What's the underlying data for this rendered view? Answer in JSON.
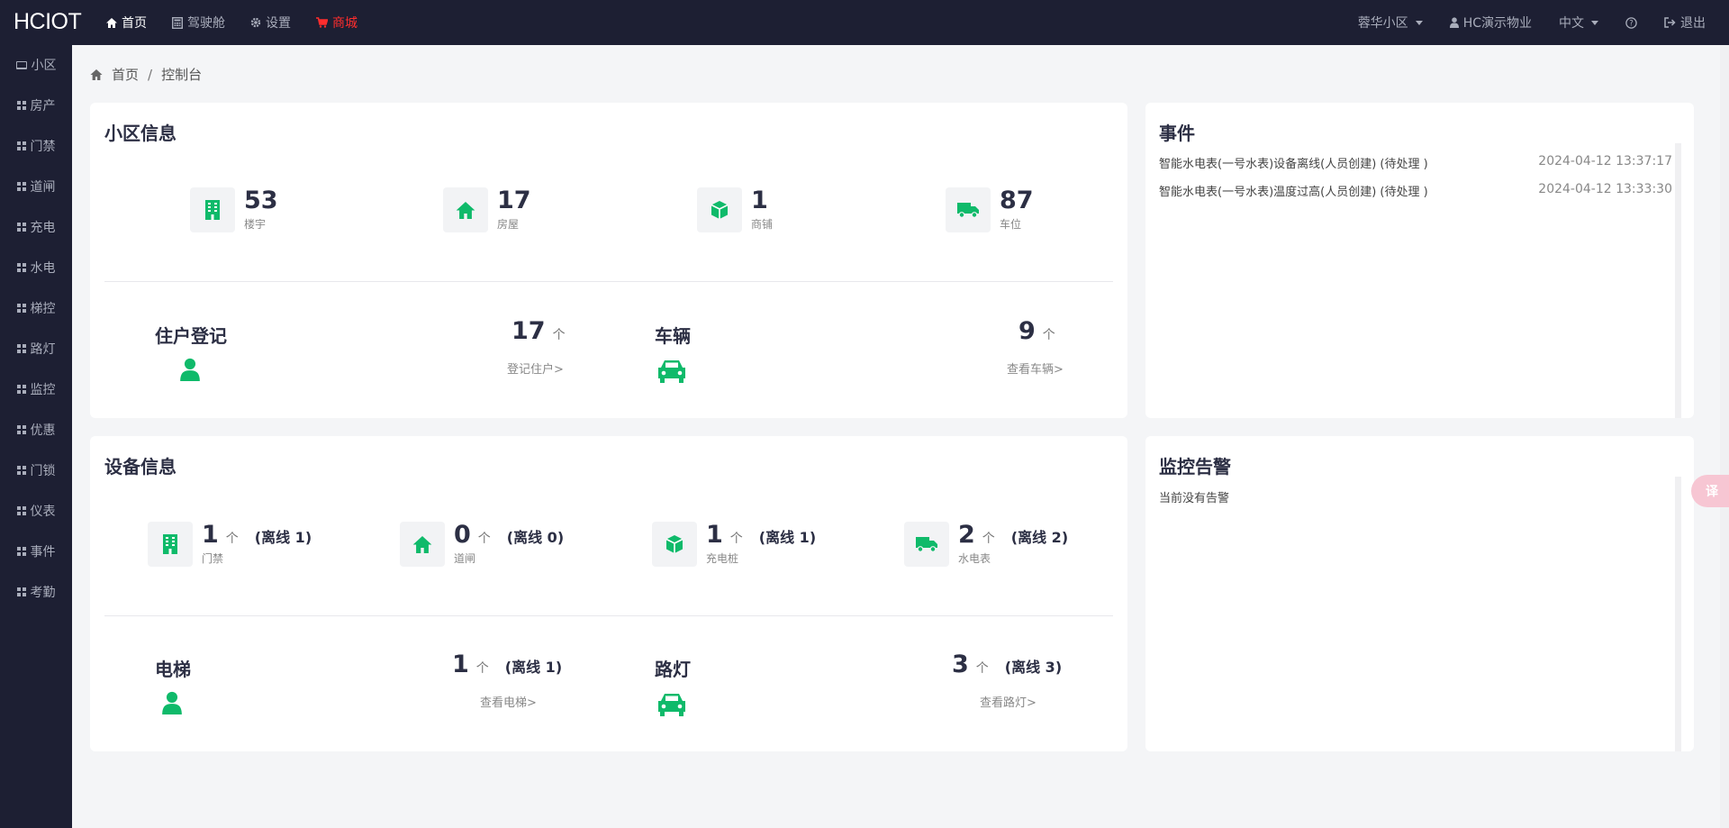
{
  "brand": "HCIOT",
  "topnav": [
    {
      "label": "首页",
      "icon": "home-icon",
      "active": true
    },
    {
      "label": "驾驶舱",
      "icon": "calculator-icon"
    },
    {
      "label": "设置",
      "icon": "gear-icon"
    },
    {
      "label": "商城",
      "icon": "cart-icon"
    }
  ],
  "topright": {
    "community": "蓉华小区",
    "company": "HC演示物业",
    "language": "中文",
    "help_icon": "question-circle-icon",
    "logout": "退出"
  },
  "sidebar": [
    {
      "label": "小区",
      "icon": "laptop-icon"
    },
    {
      "label": "房产",
      "icon": "grid-icon"
    },
    {
      "label": "门禁",
      "icon": "grid-icon"
    },
    {
      "label": "道闸",
      "icon": "grid-icon"
    },
    {
      "label": "充电",
      "icon": "grid-icon"
    },
    {
      "label": "水电",
      "icon": "grid-icon"
    },
    {
      "label": "梯控",
      "icon": "grid-icon"
    },
    {
      "label": "路灯",
      "icon": "grid-icon"
    },
    {
      "label": "监控",
      "icon": "grid-icon"
    },
    {
      "label": "优惠",
      "icon": "grid-icon"
    },
    {
      "label": "门锁",
      "icon": "grid-icon"
    },
    {
      "label": "仪表",
      "icon": "grid-icon"
    },
    {
      "label": "事件",
      "icon": "grid-icon"
    },
    {
      "label": "考勤",
      "icon": "grid-icon"
    }
  ],
  "breadcrumb": {
    "home": "首页",
    "sep": "/",
    "current": "控制台"
  },
  "community_info": {
    "title": "小区信息",
    "stats": [
      {
        "value": "53",
        "label": "楼宇",
        "icon": "building-icon"
      },
      {
        "value": "17",
        "label": "房屋",
        "icon": "home-icon"
      },
      {
        "value": "1",
        "label": "商铺",
        "icon": "cube-icon"
      },
      {
        "value": "87",
        "label": "车位",
        "icon": "truck-icon"
      }
    ],
    "resident": {
      "title": "住户登记",
      "count": "17",
      "unit": "个",
      "link": "登记住户>"
    },
    "vehicle": {
      "title": "车辆",
      "count": "9",
      "unit": "个",
      "link": "查看车辆>"
    }
  },
  "device_info": {
    "title": "设备信息",
    "stats": [
      {
        "value": "1",
        "unit": "个",
        "offline": "(离线 1)",
        "label": "门禁",
        "icon": "building-icon"
      },
      {
        "value": "0",
        "unit": "个",
        "offline": "(离线 0)",
        "label": "道闸",
        "icon": "home-icon"
      },
      {
        "value": "1",
        "unit": "个",
        "offline": "(离线 1)",
        "label": "充电桩",
        "icon": "cube-icon"
      },
      {
        "value": "2",
        "unit": "个",
        "offline": "(离线 2)",
        "label": "水电表",
        "icon": "truck-icon"
      }
    ],
    "elevator": {
      "title": "电梯",
      "count": "1",
      "unit": "个",
      "offline": "(离线 1)",
      "link": "查看电梯>"
    },
    "streetlight": {
      "title": "路灯",
      "count": "3",
      "unit": "个",
      "offline": "(离线 3)",
      "link": "查看路灯>"
    }
  },
  "events": {
    "title": "事件",
    "items": [
      {
        "text": "智能水电表(一号水表)设备离线(人员创建) (待处理 )",
        "time": "2024-04-12 13:37:17"
      },
      {
        "text": "智能水电表(一号水表)温度过高(人员创建) (待处理 )",
        "time": "2024-04-12 13:33:30"
      }
    ]
  },
  "monitor_alerts": {
    "title": "监控告警",
    "empty_text": "当前没有告警"
  },
  "floating_button": "译",
  "colors": {
    "accent": "#0fba6a",
    "nav_bg": "#1d1f33",
    "mall": "#ff2d2d"
  }
}
